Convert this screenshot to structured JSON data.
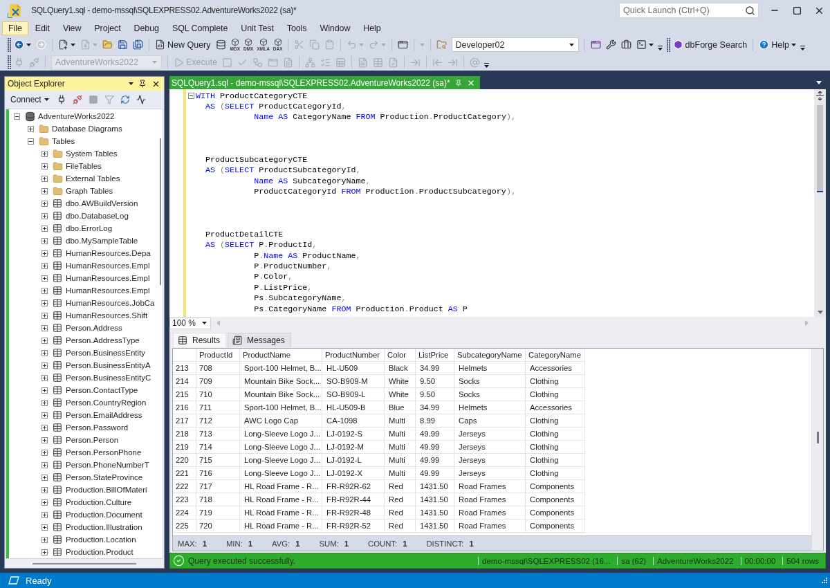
{
  "window": {
    "title": "SQLQuery1.sql - demo-mssql\\SQLEXPRESS02.AdventureWorks2022 (sa)*",
    "quick_launch": {
      "placeholder": "Quick Launch (Ctrl+Q)"
    }
  },
  "menu": [
    {
      "label": "File",
      "selected": true
    },
    {
      "label": "Edit",
      "selected": false
    },
    {
      "label": "View",
      "selected": false
    },
    {
      "label": "Project",
      "selected": false
    },
    {
      "label": "Debug",
      "selected": false
    },
    {
      "label": "SQL Complete",
      "selected": false
    },
    {
      "label": "Unit Test",
      "selected": false
    },
    {
      "label": "Tools",
      "selected": false
    },
    {
      "label": "Window",
      "selected": false
    },
    {
      "label": "Help",
      "selected": false
    }
  ],
  "toolbar_rows": [
    {
      "toolbars": [
        {
          "groups": [
            {
              "items": [
                {
                  "kind": "icon",
                  "disabled": false,
                  "dropdown": true
                },
                {
                  "kind": "icon",
                  "disabled": true,
                  "dropdown": false
                }
              ]
            },
            {
              "items": [
                {
                  "kind": "icon",
                  "disabled": false,
                  "dropdown": true
                },
                {
                  "kind": "icon",
                  "disabled": true,
                  "dropdown": true
                },
                {
                  "kind": "icon",
                  "disabled": false,
                  "dropdown": false
                },
                {
                  "kind": "icon",
                  "disabled": false,
                  "dropdown": false
                },
                {
                  "kind": "icon",
                  "disabled": false,
                  "dropdown": false
                }
              ]
            },
            {
              "items": [
                {
                  "kind": "button",
                  "label": "New Query",
                  "disabled": false,
                  "dropdown": false
                },
                {
                  "kind": "icon",
                  "disabled": false,
                  "dropdown": false
                },
                {
                  "kind": "tagged",
                  "label": "MDX",
                  "disabled": false
                },
                {
                  "kind": "tagged",
                  "label": "DMX",
                  "disabled": false
                },
                {
                  "kind": "tagged",
                  "label": "XMLA",
                  "disabled": false
                },
                {
                  "kind": "tagged",
                  "label": "DAX",
                  "disabled": false
                }
              ]
            },
            {
              "items": [
                {
                  "kind": "icon",
                  "disabled": true,
                  "dropdown": false
                },
                {
                  "kind": "icon",
                  "disabled": true,
                  "dropdown": false
                },
                {
                  "kind": "icon",
                  "disabled": true,
                  "dropdown": false
                }
              ]
            },
            {
              "items": [
                {
                  "kind": "icon",
                  "disabled": true,
                  "dropdown": true
                },
                {
                  "kind": "icon",
                  "disabled": true,
                  "dropdown": true
                }
              ]
            },
            {
              "items": [
                {
                  "kind": "icon",
                  "disabled": false,
                  "dropdown": false
                }
              ]
            },
            {
              "items": [
                {
                  "kind": "caret",
                  "disabled": true
                }
              ]
            },
            {
              "items": [
                {
                  "kind": "icon",
                  "disabled": false,
                  "dropdown": false
                },
                {
                  "kind": "combo",
                  "value": "Developer02",
                  "disabled": false
                }
              ]
            },
            {
              "items": [
                {
                  "kind": "icon",
                  "disabled": false,
                  "dropdown": false
                },
                {
                  "kind": "icon",
                  "disabled": false,
                  "dropdown": false
                },
                {
                  "kind": "icon",
                  "disabled": false,
                  "dropdown": false
                },
                {
                  "kind": "icon",
                  "disabled": false,
                  "dropdown": true
                }
              ]
            }
          ]
        },
        {
          "groups": [
            {
              "items": [
                {
                  "kind": "button",
                  "label": "dbForge Search",
                  "disabled": false,
                  "dropdown": false
                }
              ]
            },
            {
              "items": [
                {
                  "kind": "button",
                  "label": "Help",
                  "disabled": false,
                  "dropdown": true
                }
              ]
            }
          ]
        }
      ]
    },
    {
      "toolbars": [
        {
          "groups": [
            {
              "items": [
                {
                  "kind": "icon",
                  "disabled": true,
                  "dropdown": false
                },
                {
                  "kind": "icon",
                  "disabled": true,
                  "dropdown": false
                }
              ]
            },
            {
              "items": [
                {
                  "kind": "combo",
                  "value": "AdventureWorks2022",
                  "disabled": true
                }
              ]
            },
            {
              "items": [
                {
                  "kind": "button",
                  "label": "Execute",
                  "disabled": true,
                  "dropdown": false
                },
                {
                  "kind": "icon",
                  "disabled": true,
                  "dropdown": false
                },
                {
                  "kind": "icon",
                  "disabled": true,
                  "dropdown": false
                },
                {
                  "kind": "icon",
                  "disabled": true,
                  "dropdown": false
                },
                {
                  "kind": "icon",
                  "disabled": true,
                  "dropdown": false
                },
                {
                  "kind": "icon",
                  "disabled": true,
                  "dropdown": false
                }
              ]
            },
            {
              "items": [
                {
                  "kind": "icon",
                  "disabled": true,
                  "dropdown": false
                },
                {
                  "kind": "icon",
                  "disabled": true,
                  "dropdown": false
                },
                {
                  "kind": "icon",
                  "disabled": true,
                  "dropdown": false
                }
              ]
            },
            {
              "items": [
                {
                  "kind": "icon",
                  "disabled": true,
                  "dropdown": false
                },
                {
                  "kind": "icon",
                  "disabled": true,
                  "dropdown": false
                },
                {
                  "kind": "icon",
                  "disabled": true,
                  "dropdown": false
                }
              ]
            },
            {
              "items": [
                {
                  "kind": "icon",
                  "disabled": true,
                  "dropdown": false
                }
              ]
            },
            {
              "items": [
                {
                  "kind": "icon",
                  "disabled": true,
                  "dropdown": false
                },
                {
                  "kind": "icon",
                  "disabled": true,
                  "dropdown": false
                }
              ]
            },
            {
              "items": [
                {
                  "kind": "icon",
                  "disabled": true,
                  "dropdown": false
                }
              ]
            }
          ]
        }
      ]
    }
  ],
  "object_explorer": {
    "title": "Object Explorer",
    "connect": "Connect",
    "tools": [
      {
        "disabled": false
      },
      {
        "disabled": false
      },
      {
        "disabled": true
      },
      {
        "disabled": true
      },
      {
        "disabled": false
      },
      {
        "disabled": false
      }
    ],
    "tree": [
      {
        "label": "AdventureWorks2022",
        "kind": "database",
        "expanded": true,
        "children": [
          {
            "label": "Database Diagrams",
            "kind": "folder",
            "expanded": false
          },
          {
            "label": "Tables",
            "kind": "folder",
            "expanded": true,
            "children": [
              {
                "label": "System Tables",
                "kind": "folder",
                "expanded": false
              },
              {
                "label": "FileTables",
                "kind": "folder",
                "expanded": false
              },
              {
                "label": "External Tables",
                "kind": "folder",
                "expanded": false
              },
              {
                "label": "Graph Tables",
                "kind": "folder",
                "expanded": false
              },
              {
                "label": "dbo.AWBuildVersion",
                "kind": "table",
                "expanded": false
              },
              {
                "label": "dbo.DatabaseLog",
                "kind": "table",
                "expanded": false
              },
              {
                "label": "dbo.ErrorLog",
                "kind": "table",
                "expanded": false
              },
              {
                "label": "dbo.MySampleTable",
                "kind": "table",
                "expanded": false
              },
              {
                "label": "HumanResources.Depa",
                "kind": "table",
                "expanded": false
              },
              {
                "label": "HumanResources.Empl",
                "kind": "table",
                "expanded": false
              },
              {
                "label": "HumanResources.Empl",
                "kind": "table",
                "expanded": false
              },
              {
                "label": "HumanResources.Empl",
                "kind": "table",
                "expanded": false
              },
              {
                "label": "HumanResources.JobCa",
                "kind": "table",
                "expanded": false
              },
              {
                "label": "HumanResources.Shift",
                "kind": "table",
                "expanded": false
              },
              {
                "label": "Person.Address",
                "kind": "table",
                "expanded": false
              },
              {
                "label": "Person.AddressType",
                "kind": "table",
                "expanded": false
              },
              {
                "label": "Person.BusinessEntity",
                "kind": "table",
                "expanded": false
              },
              {
                "label": "Person.BusinessEntityA",
                "kind": "table",
                "expanded": false
              },
              {
                "label": "Person.BusinessEntityC",
                "kind": "table",
                "expanded": false
              },
              {
                "label": "Person.ContactType",
                "kind": "table",
                "expanded": false
              },
              {
                "label": "Person.CountryRegion",
                "kind": "table",
                "expanded": false
              },
              {
                "label": "Person.EmailAddress",
                "kind": "table",
                "expanded": false
              },
              {
                "label": "Person.Password",
                "kind": "table",
                "expanded": false
              },
              {
                "label": "Person.Person",
                "kind": "table",
                "expanded": false
              },
              {
                "label": "Person.PersonPhone",
                "kind": "table",
                "expanded": false
              },
              {
                "label": "Person.PhoneNumberT",
                "kind": "table",
                "expanded": false
              },
              {
                "label": "Person.StateProvince",
                "kind": "table",
                "expanded": false
              },
              {
                "label": "Production.BillOfMateri",
                "kind": "table",
                "expanded": false
              },
              {
                "label": "Production.Culture",
                "kind": "table",
                "expanded": false
              },
              {
                "label": "Production.Document",
                "kind": "table",
                "expanded": false
              },
              {
                "label": "Production.Illustration",
                "kind": "table",
                "expanded": false
              },
              {
                "label": "Production.Location",
                "kind": "table",
                "expanded": false
              },
              {
                "label": "Production.Product",
                "kind": "table",
                "expanded": false
              }
            ]
          }
        ]
      }
    ]
  },
  "editor": {
    "tab": {
      "title": "SQLQuery1.sql - demo-mssql\\SQLEXPRESS02.AdventureWorks2022 (sa)*",
      "selected": true
    },
    "modified": true,
    "blocks": [
      {
        "lines": [
          {
            "kind": "start",
            "fold": true,
            "tokens": [
              {
                "text": "WITH",
                "kind": "keyword"
              },
              {
                "text": " ProductCategoryCTE",
                "kind": "identifier"
              }
            ]
          },
          {
            "kind": "clause",
            "fold": false,
            "tokens": [
              {
                "text": "AS",
                "kind": "keyword"
              },
              {
                "text": " (",
                "kind": "punctuation"
              },
              {
                "text": "SELECT",
                "kind": "keyword"
              },
              {
                "text": " ProductCategoryId",
                "kind": "identifier"
              },
              {
                "text": ",",
                "kind": "punctuation"
              }
            ]
          },
          {
            "kind": "continued",
            "fold": false,
            "tokens": [
              {
                "text": "Name",
                "kind": "keyword"
              },
              {
                "text": " AS",
                "kind": "keyword"
              },
              {
                "text": " CategoryName",
                "kind": "identifier"
              },
              {
                "text": " FROM",
                "kind": "keyword"
              },
              {
                "text": " Production",
                "kind": "identifier"
              },
              {
                "text": ".",
                "kind": "punctuation"
              },
              {
                "text": "ProductCategory",
                "kind": "identifier"
              },
              {
                "text": "),",
                "kind": "punctuation"
              }
            ]
          }
        ]
      },
      {
        "lines": [
          {
            "kind": "clause",
            "fold": false,
            "tokens": [
              {
                "text": "ProductSubcategoryCTE",
                "kind": "identifier"
              }
            ]
          },
          {
            "kind": "clause",
            "fold": false,
            "tokens": [
              {
                "text": "AS",
                "kind": "keyword"
              },
              {
                "text": " (",
                "kind": "punctuation"
              },
              {
                "text": "SELECT",
                "kind": "keyword"
              },
              {
                "text": " ProductSubcategoryId",
                "kind": "identifier"
              },
              {
                "text": ",",
                "kind": "punctuation"
              }
            ]
          },
          {
            "kind": "continued",
            "fold": false,
            "tokens": [
              {
                "text": "Name",
                "kind": "keyword"
              },
              {
                "text": " AS",
                "kind": "keyword"
              },
              {
                "text": " SubcategoryName",
                "kind": "identifier"
              },
              {
                "text": ",",
                "kind": "punctuation"
              }
            ]
          },
          {
            "kind": "continued",
            "fold": false,
            "tokens": [
              {
                "text": "ProductCategoryId",
                "kind": "identifier"
              },
              {
                "text": " FROM",
                "kind": "keyword"
              },
              {
                "text": " Production",
                "kind": "identifier"
              },
              {
                "text": ".",
                "kind": "punctuation"
              },
              {
                "text": "ProductSubcategory",
                "kind": "identifier"
              },
              {
                "text": "),",
                "kind": "punctuation"
              }
            ]
          }
        ]
      },
      {
        "lines": [
          {
            "kind": "clause",
            "fold": false,
            "tokens": [
              {
                "text": "ProductDetailCTE",
                "kind": "identifier"
              }
            ]
          },
          {
            "kind": "clause",
            "fold": false,
            "tokens": [
              {
                "text": "AS",
                "kind": "keyword"
              },
              {
                "text": " (",
                "kind": "punctuation"
              },
              {
                "text": "SELECT",
                "kind": "keyword"
              },
              {
                "text": " P",
                "kind": "identifier"
              },
              {
                "text": ".",
                "kind": "punctuation"
              },
              {
                "text": "ProductId",
                "kind": "identifier"
              },
              {
                "text": ",",
                "kind": "punctuation"
              }
            ]
          },
          {
            "kind": "continued",
            "fold": false,
            "tokens": [
              {
                "text": "P",
                "kind": "identifier"
              },
              {
                "text": ".",
                "kind": "punctuation"
              },
              {
                "text": "Name",
                "kind": "keyword"
              },
              {
                "text": " AS",
                "kind": "keyword"
              },
              {
                "text": " ProductName",
                "kind": "identifier"
              },
              {
                "text": ",",
                "kind": "punctuation"
              }
            ]
          },
          {
            "kind": "continued",
            "fold": false,
            "tokens": [
              {
                "text": "P",
                "kind": "identifier"
              },
              {
                "text": ".",
                "kind": "punctuation"
              },
              {
                "text": "ProductNumber",
                "kind": "identifier"
              },
              {
                "text": ",",
                "kind": "punctuation"
              }
            ]
          },
          {
            "kind": "continued",
            "fold": false,
            "tokens": [
              {
                "text": "P",
                "kind": "identifier"
              },
              {
                "text": ".",
                "kind": "punctuation"
              },
              {
                "text": "Color",
                "kind": "identifier"
              },
              {
                "text": ",",
                "kind": "punctuation"
              }
            ]
          },
          {
            "kind": "continued",
            "fold": false,
            "tokens": [
              {
                "text": "P",
                "kind": "identifier"
              },
              {
                "text": ".",
                "kind": "punctuation"
              },
              {
                "text": "ListPrice",
                "kind": "identifier"
              },
              {
                "text": ",",
                "kind": "punctuation"
              }
            ]
          },
          {
            "kind": "continued",
            "fold": false,
            "tokens": [
              {
                "text": "Ps",
                "kind": "identifier"
              },
              {
                "text": ".",
                "kind": "punctuation"
              },
              {
                "text": "SubcategoryName",
                "kind": "identifier"
              },
              {
                "text": ",",
                "kind": "punctuation"
              }
            ]
          },
          {
            "kind": "continued",
            "fold": false,
            "tokens": [
              {
                "text": "Ps",
                "kind": "identifier"
              },
              {
                "text": ".",
                "kind": "punctuation"
              },
              {
                "text": "CategoryName",
                "kind": "identifier"
              },
              {
                "text": " FROM",
                "kind": "keyword"
              },
              {
                "text": " Production",
                "kind": "identifier"
              },
              {
                "text": ".",
                "kind": "punctuation"
              },
              {
                "text": "Product",
                "kind": "identifier"
              },
              {
                "text": " AS",
                "kind": "keyword"
              },
              {
                "text": " P",
                "kind": "identifier"
              }
            ]
          }
        ]
      }
    ],
    "zoom": "100 %"
  },
  "results": {
    "tabs": [
      {
        "label": "Results",
        "selected": true
      },
      {
        "label": "Messages",
        "selected": false
      }
    ],
    "columns": [
      "ProductId",
      "ProductName",
      "ProductNumber",
      "Color",
      "ListPrice",
      "SubcategoryName",
      "CategoryName"
    ],
    "rows": [
      {
        "number": "213",
        "cells": [
          "708",
          "Sport-100 Helmet, B...",
          "HL-U509",
          "Black",
          "34.99",
          "Helmets",
          "Accessories"
        ]
      },
      {
        "number": "214",
        "cells": [
          "709",
          "Mountain Bike Sock...",
          "SO-B909-M",
          "White",
          "9.50",
          "Socks",
          "Clothing"
        ]
      },
      {
        "number": "215",
        "cells": [
          "710",
          "Mountain Bike Sock...",
          "SO-B909-L",
          "White",
          "9.50",
          "Socks",
          "Clothing"
        ]
      },
      {
        "number": "216",
        "cells": [
          "711",
          "Sport-100 Helmet, B...",
          "HL-U509-B",
          "Blue",
          "34.99",
          "Helmets",
          "Accessories"
        ]
      },
      {
        "number": "217",
        "cells": [
          "712",
          "AWC Logo Cap",
          "CA-1098",
          "Multi",
          "8.99",
          "Caps",
          "Clothing"
        ]
      },
      {
        "number": "218",
        "cells": [
          "713",
          "Long-Sleeve Logo J...",
          "LJ-0192-S",
          "Multi",
          "49.99",
          "Jerseys",
          "Clothing"
        ]
      },
      {
        "number": "219",
        "cells": [
          "714",
          "Long-Sleeve Logo J...",
          "LJ-0192-M",
          "Multi",
          "49.99",
          "Jerseys",
          "Clothing"
        ]
      },
      {
        "number": "220",
        "cells": [
          "715",
          "Long-Sleeve Logo J...",
          "LJ-0192-L",
          "Multi",
          "49.99",
          "Jerseys",
          "Clothing"
        ]
      },
      {
        "number": "221",
        "cells": [
          "716",
          "Long-Sleeve Logo J...",
          "LJ-0192-X",
          "Multi",
          "49.99",
          "Jerseys",
          "Clothing"
        ]
      },
      {
        "number": "222",
        "cells": [
          "717",
          "HL Road Frame - R...",
          "FR-R92R-62",
          "Red",
          "1431.50",
          "Road Frames",
          "Components"
        ]
      },
      {
        "number": "223",
        "cells": [
          "718",
          "HL Road Frame - R...",
          "FR-R92R-44",
          "Red",
          "1431.50",
          "Road Frames",
          "Components"
        ]
      },
      {
        "number": "224",
        "cells": [
          "719",
          "HL Road Frame - R...",
          "FR-R92R-48",
          "Red",
          "1431.50",
          "Road Frames",
          "Components"
        ]
      },
      {
        "number": "225",
        "cells": [
          "720",
          "HL Road Frame - R...",
          "FR-R92R-52",
          "Red",
          "1431.50",
          "Road Frames",
          "Components"
        ]
      }
    ],
    "aggregates": [
      {
        "label": "MAX:",
        "value": "1"
      },
      {
        "label": "MIN:",
        "value": "1"
      },
      {
        "label": "AVG:",
        "value": "1"
      },
      {
        "label": "SUM:",
        "value": "1"
      },
      {
        "label": "COUNT:",
        "value": "1"
      },
      {
        "label": "DISTINCT:",
        "value": "1"
      }
    ]
  },
  "query_status": {
    "message": "Query executed successfully.",
    "segments": [
      "demo-mssql\\SQLEXPRESS02 (16...",
      "sa (62)",
      "AdventureWorks2022",
      "00:00:00",
      "504 rows"
    ]
  },
  "status_bar": {
    "text": "Ready"
  }
}
